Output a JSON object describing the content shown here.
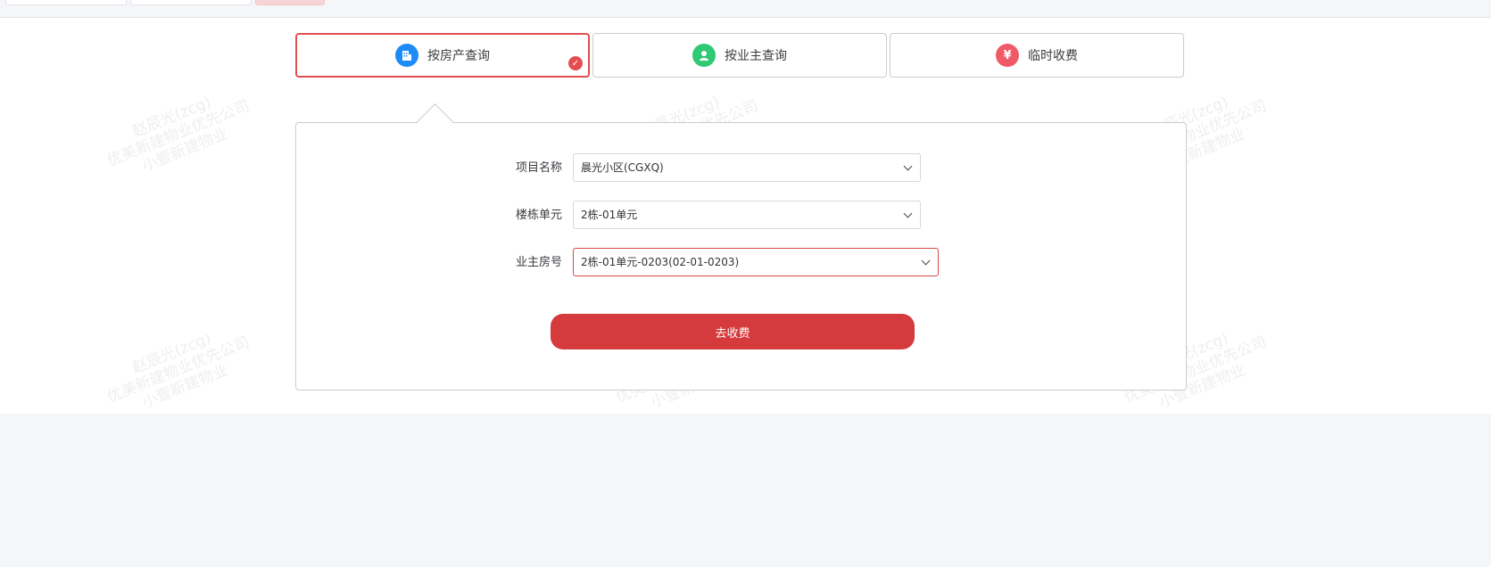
{
  "modes": [
    {
      "label": "按房产查询",
      "icon": "building-icon",
      "icon_glyph": "▥",
      "color": "#1d8cf8",
      "active": true
    },
    {
      "label": "按业主查询",
      "icon": "user-icon",
      "icon_glyph": "●",
      "color": "#2fc873",
      "active": false
    },
    {
      "label": "临时收费",
      "icon": "yen-icon",
      "icon_glyph": "¥",
      "color": "#f05a67",
      "active": false
    }
  ],
  "form": {
    "project": {
      "label": "项目名称",
      "value": "晨光小区(CGXQ)"
    },
    "building": {
      "label": "楼栋单元",
      "value": "2栋-01单元"
    },
    "room": {
      "label": "业主房号",
      "value": "2栋-01单元-0203(02-01-0203)"
    },
    "submit_label": "去收费"
  },
  "watermark": {
    "line1": "赵辰光(zcg)",
    "line2": "优美新建物业优先公司",
    "line3": "小壹新建物业"
  },
  "colors": {
    "accent_red": "#d53a3c",
    "border": "#c9ccd3"
  }
}
